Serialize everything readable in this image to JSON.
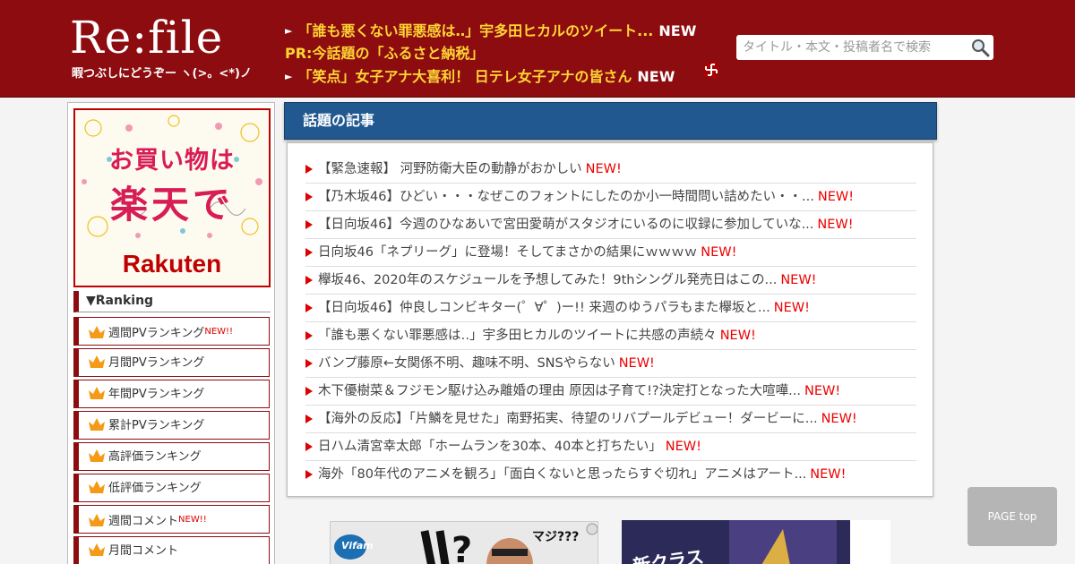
{
  "header": {
    "logo": "Re:file",
    "tagline": "暇つぶしにどうぞー ヽ(>。<*)ノ",
    "tickers": [
      {
        "text": "「誰も悪くない罪悪感は‥」宇多田ヒカルのツイート...",
        "badge": "NEW",
        "arrow": "►"
      },
      {
        "text": "PR:今話題の「ふるさと納税」",
        "badge": "",
        "arrow": ""
      },
      {
        "text": "「笑点」女子アナ大喜利！ 日テレ女子アナの皆さん",
        "badge": "NEW",
        "arrow": "►"
      }
    ],
    "search_placeholder": "タイトル・本文・投稿者名で検索"
  },
  "sidebar": {
    "banner": {
      "line1": "お買い物は",
      "line2": "楽天で",
      "brand": "Rakuten"
    },
    "ranking_title": "▼Ranking",
    "items": [
      {
        "label": "週間PVランキング",
        "badge": "NEW!!"
      },
      {
        "label": "月間PVランキング",
        "badge": ""
      },
      {
        "label": "年間PVランキング",
        "badge": ""
      },
      {
        "label": "累計PVランキング",
        "badge": ""
      },
      {
        "label": "高評価ランキング",
        "badge": ""
      },
      {
        "label": "低評価ランキング",
        "badge": ""
      },
      {
        "label": "週間コメント",
        "badge": "NEW!!"
      },
      {
        "label": "月間コメント",
        "badge": ""
      }
    ]
  },
  "main": {
    "heading": "話題の記事",
    "articles": [
      {
        "title": "【緊急速報】 河野防衛大臣の動静がおかしい",
        "badge": "NEW!"
      },
      {
        "title": "【乃木坂46】ひどい・・・なぜこのフォントにしたのか小一時間問い詰めたい・・...",
        "badge": "NEW!"
      },
      {
        "title": "【日向坂46】今週のひなあいで宮田愛萌がスタジオにいるのに収録に参加していな...",
        "badge": "NEW!"
      },
      {
        "title": "日向坂46「ネプリーグ」に登場！そしてまさかの結果にｗｗｗｗ",
        "badge": "NEW!"
      },
      {
        "title": "欅坂46、2020年のスケジュールを予想してみた！9thシングル発売日はこの...",
        "badge": "NEW!"
      },
      {
        "title": "【日向坂46】仲良しコンビキター(゜∀゜)ー!! 来週のゆうパラもまた欅坂と...",
        "badge": "NEW!"
      },
      {
        "title": "「誰も悪くない罪悪感は‥」宇多田ヒカルのツイートに共感の声続々",
        "badge": "NEW!"
      },
      {
        "title": "バンプ藤原←女関係不明、趣味不明、SNSやらない",
        "badge": "NEW!"
      },
      {
        "title": "木下優樹菜＆フジモン駆け込み離婚の理由 原因は子育て!?決定打となった大喧嘩...",
        "badge": "NEW!"
      },
      {
        "title": "【海外の反応】「片鱗を見せた」南野拓実、待望のリバプールデビュー！ダービーに...",
        "badge": "NEW!"
      },
      {
        "title": "日ハム清宮幸太郎「ホームランを30本、40本と打ちたい」",
        "badge": "NEW!"
      },
      {
        "title": "海外「80年代のアニメを観ろ」「面白くないと思ったらすぐ切れ」アニメはアート...",
        "badge": "NEW!"
      }
    ]
  },
  "ads": {
    "ad1_text": "マジ???",
    "ad1_brand": "Vifam",
    "ad2_text": "新クラス"
  },
  "pagetop": "PAGE top",
  "colors": {
    "header_bg": "#8c0c10",
    "ticker": "#ffd634",
    "heading_bg": "#20588f",
    "new": "#e00000"
  }
}
